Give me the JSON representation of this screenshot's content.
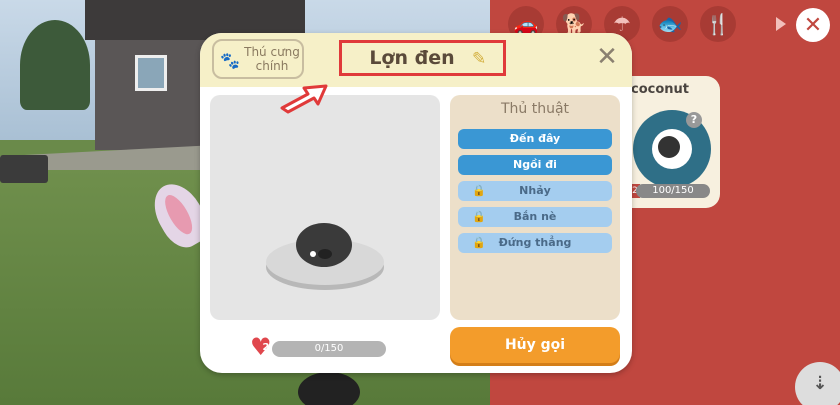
{
  "modal": {
    "main_tab_label": "Thú cưng\nchính",
    "pet_name": "Lợn đen",
    "close_symbol": "✕",
    "tricks_title": "Thủ thuật",
    "tricks": [
      {
        "label": "Đến đây",
        "locked": false
      },
      {
        "label": "Ngồi đi",
        "locked": false
      },
      {
        "label": "Nhảy",
        "locked": true
      },
      {
        "label": "Bắn nè",
        "locked": true
      },
      {
        "label": "Đứng thẳng",
        "locked": true
      }
    ],
    "hearts_level": "2",
    "hearts_progress": "0/150",
    "cancel_button": "Hủy gọi"
  },
  "side_card": {
    "pet_name": "coconut",
    "level": "2",
    "progress": "100/150",
    "help_symbol": "?"
  },
  "colors": {
    "accent_orange": "#f39c2b",
    "trick_active": "#3a97d4",
    "trick_locked": "#a4cdef",
    "highlight_red": "#e03a3a",
    "panel_bg": "#c0473f"
  },
  "icons": [
    "paw-icon",
    "pencil-icon",
    "close-icon",
    "lock-icon",
    "heart-icon",
    "arrow-icon"
  ]
}
